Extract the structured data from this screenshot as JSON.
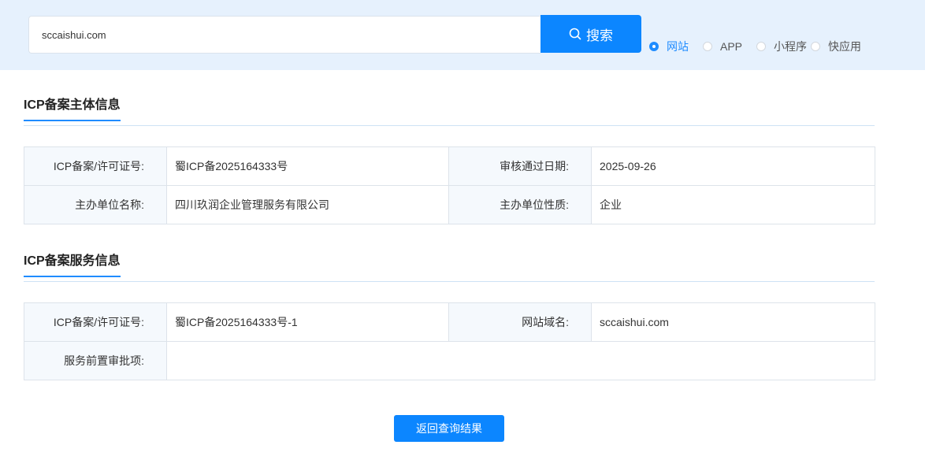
{
  "search": {
    "value": "sccaishui.com",
    "button_label": "搜索"
  },
  "type_options": [
    {
      "label": "网站",
      "checked": true
    },
    {
      "label": "APP",
      "checked": false
    },
    {
      "label": "小程序",
      "checked": false
    },
    {
      "label": "快应用",
      "checked": false
    }
  ],
  "subject_section": {
    "title": "ICP备案主体信息",
    "rows": [
      [
        {
          "label": "ICP备案/许可证号:",
          "value": "蜀ICP备2025164333号"
        },
        {
          "label": "审核通过日期:",
          "value": "2025-09-26"
        }
      ],
      [
        {
          "label": "主办单位名称:",
          "value": "四川玖润企业管理服务有限公司"
        },
        {
          "label": "主办单位性质:",
          "value": "企业"
        }
      ]
    ]
  },
  "service_section": {
    "title": "ICP备案服务信息",
    "rows": [
      [
        {
          "label": "ICP备案/许可证号:",
          "value": "蜀ICP备2025164333号-1"
        },
        {
          "label": "网站域名:",
          "value": "sccaishui.com"
        }
      ],
      [
        {
          "label": "服务前置审批项:",
          "value": ""
        }
      ]
    ]
  },
  "back_button_label": "返回查询结果",
  "colors": {
    "accent": "#0c86ff",
    "topbar_bg": "#e6f1fd",
    "label_cell_bg": "#f5f9fd",
    "border": "#dde3ea"
  },
  "icons": {
    "search": "search-icon"
  }
}
